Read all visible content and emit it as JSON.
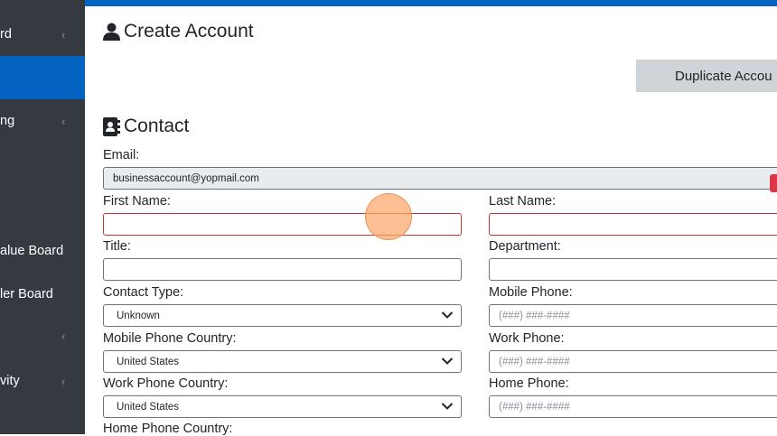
{
  "sidebar": {
    "items": [
      {
        "label": "rd",
        "chevron": "‹"
      },
      {
        "label": "",
        "chevron": ""
      },
      {
        "label": "ng",
        "chevron": "‹"
      },
      {
        "label": "",
        "chevron": ""
      },
      {
        "label": "alue Board",
        "chevron": ""
      },
      {
        "label": "ler Board",
        "chevron": ""
      },
      {
        "label": "",
        "chevron": "‹"
      },
      {
        "label": "vity",
        "chevron": "‹"
      }
    ],
    "active_color": "#0563c1"
  },
  "header": {
    "title": "Create Account",
    "title_icon": "user-icon"
  },
  "actions": {
    "duplicate_label": "Duplicate Accou"
  },
  "contact": {
    "title": "Contact",
    "title_icon": "address-book-icon",
    "email_label": "Email:",
    "email_value": "businessaccount@yopmail.com",
    "first_name_label": "First Name:",
    "first_name_value": "",
    "last_name_label": "Last Name:",
    "last_name_value": "",
    "title_label": "Title:",
    "title_value": "",
    "department_label": "Department:",
    "department_value": "",
    "contact_type_label": "Contact Type:",
    "contact_type_value": "Unknown",
    "mobile_phone_label": "Mobile Phone:",
    "mobile_phone_placeholder": "(###) ###-####",
    "mobile_country_label": "Mobile Phone Country:",
    "mobile_country_value": "United States",
    "work_phone_label": "Work Phone:",
    "work_phone_placeholder": "(###) ###-####",
    "work_country_label": "Work Phone Country:",
    "work_country_value": "United States",
    "home_phone_label": "Home Phone:",
    "home_phone_placeholder": "(###) ###-####",
    "home_country_label": "Home Phone Country:"
  },
  "colors": {
    "sidebar_bg": "#343a40",
    "accent": "#0563c1",
    "error_border": "#c0392b",
    "button_bg": "#cfd4d9"
  }
}
